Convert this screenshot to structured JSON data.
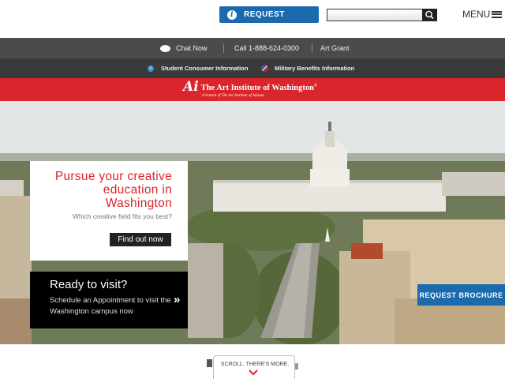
{
  "header": {
    "request_label": "REQUEST",
    "search": {
      "value": "",
      "placeholder": ""
    },
    "menu_label": "MENU"
  },
  "utility_bar": {
    "chat_label": "Chat Now",
    "phone_label": "Call 1-888-624-0300",
    "grant_label": "Art Grant"
  },
  "info_bar": {
    "consumer_label": "Student Consumer Information",
    "military_label": "Military Benefits Information"
  },
  "brand": {
    "logo_mark": "Ai",
    "title": "The Art Institute of Washington",
    "registered": "®",
    "subtitle": "A branch of The Art Institute of Atlanta"
  },
  "hero": {
    "promo": {
      "title": "Pursue your creative education in Washington",
      "subtitle": "Which creative field fits you best?",
      "button_label": "Find out now"
    },
    "visit": {
      "title": "Ready to visit?",
      "text": "Schedule an Appointment to visit the Washington campus now",
      "arrow": "»"
    },
    "brochure_label": "REQUEST BROCHURE"
  },
  "scroll": {
    "label": "SCROLL. THERE'S MORE."
  },
  "colors": {
    "brand_red": "#d9252b",
    "action_blue": "#1a6aad",
    "dark_bar": "#4b4b4b",
    "darker_bar": "#3a3a3a"
  },
  "icons": [
    "info-icon",
    "search-icon",
    "hamburger-icon",
    "chat-bubble-icon",
    "info-dot-icon",
    "flag-icon",
    "double-chevron-icon",
    "chevron-down-icon"
  ]
}
